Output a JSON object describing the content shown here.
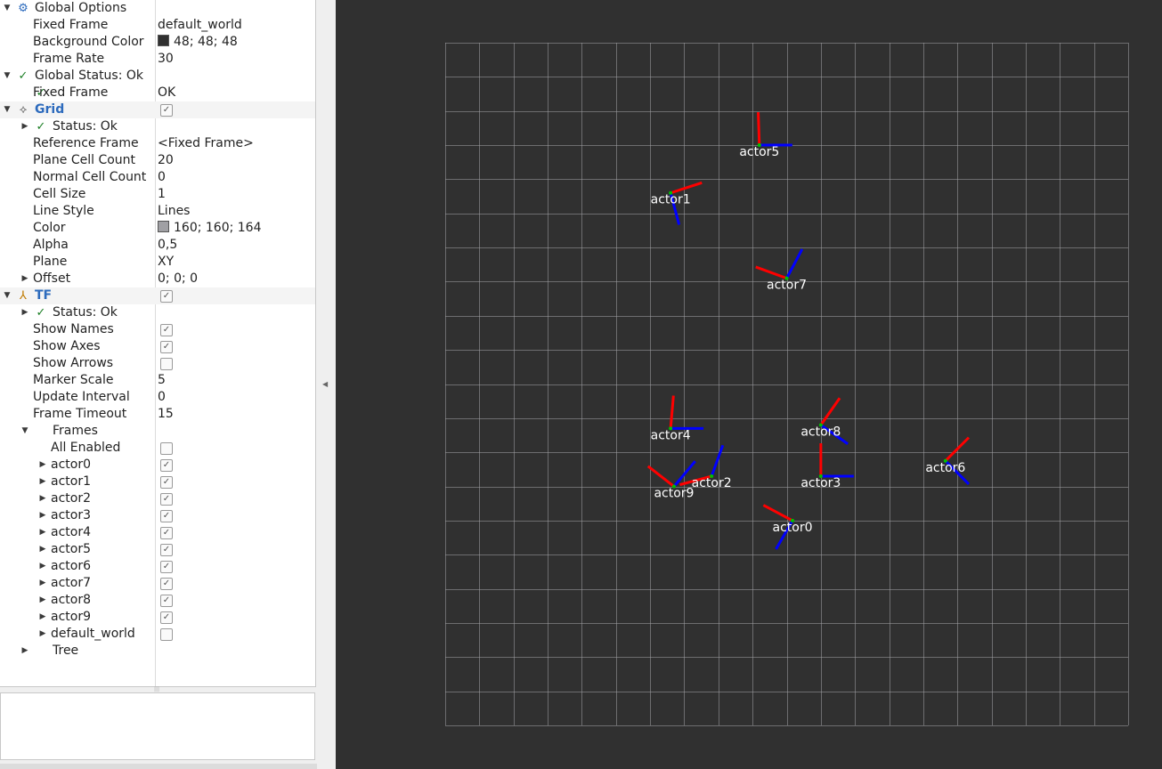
{
  "panel": {
    "rows": [
      {
        "arrow": "▼",
        "icon": "⚙",
        "icon_color": "#2d6bbd",
        "label": "Global Options",
        "value": "",
        "indent": 0,
        "name": "global-options"
      },
      {
        "label": "Fixed Frame",
        "value": "default_world",
        "indent": 2,
        "name": "fixed-frame-row"
      },
      {
        "label": "Background Color",
        "value": "48; 48; 48",
        "swatch": "#303030",
        "indent": 2,
        "name": "background-color-row"
      },
      {
        "label": "Frame Rate",
        "value": "30",
        "indent": 2,
        "name": "frame-rate-row"
      },
      {
        "arrow": "▼",
        "icon": "✓",
        "icon_color": "#1c7f25",
        "label": "Global Status: Ok",
        "value": "",
        "indent": 0,
        "name": "global-status"
      },
      {
        "icon": "✓",
        "icon_color": "#1c7f25",
        "label": "Fixed Frame",
        "value": "OK",
        "indent": 2,
        "name": "fixed-frame-status"
      },
      {
        "arrow": "▼",
        "icon": "⟡",
        "icon_color": "#555555",
        "label": "Grid",
        "value": "",
        "checkbox": true,
        "bold": true,
        "blue": true,
        "selected": true,
        "indent": 0,
        "name": "display-grid"
      },
      {
        "arrow": "▶",
        "icon": "✓",
        "icon_color": "#1c7f25",
        "label": "Status: Ok",
        "value": "",
        "indent": 1,
        "name": "grid-status"
      },
      {
        "label": "Reference Frame",
        "value": "<Fixed Frame>",
        "indent": 2,
        "name": "reference-frame-row"
      },
      {
        "label": "Plane Cell Count",
        "value": "20",
        "indent": 2,
        "name": "plane-cell-count-row"
      },
      {
        "label": "Normal Cell Count",
        "value": "0",
        "indent": 2,
        "name": "normal-cell-count-row"
      },
      {
        "label": "Cell Size",
        "value": "1",
        "indent": 2,
        "name": "cell-size-row"
      },
      {
        "label": "Line Style",
        "value": "Lines",
        "indent": 2,
        "name": "line-style-row"
      },
      {
        "label": "Color",
        "value": "160; 160; 164",
        "swatch": "#a0a0a4",
        "indent": 2,
        "name": "grid-color-row"
      },
      {
        "label": "Alpha",
        "value": "0,5",
        "indent": 2,
        "name": "alpha-row"
      },
      {
        "label": "Plane",
        "value": "XY",
        "indent": 2,
        "name": "plane-row"
      },
      {
        "arrow": "▶",
        "label": "Offset",
        "value": "0; 0; 0",
        "indent": 2,
        "name": "offset-row"
      },
      {
        "arrow": "▼",
        "icon": "⅄",
        "icon_color": "#c07a00",
        "label": "TF",
        "value": "",
        "checkbox": true,
        "bold": true,
        "blue": true,
        "selected": true,
        "indent": 0,
        "name": "display-tf"
      },
      {
        "arrow": "▶",
        "icon": "✓",
        "icon_color": "#1c7f25",
        "label": "Status: Ok",
        "value": "",
        "indent": 1,
        "name": "tf-status"
      },
      {
        "label": "Show Names",
        "value": "",
        "checkbox": true,
        "indent": 2,
        "name": "show-names-row"
      },
      {
        "label": "Show Axes",
        "value": "",
        "checkbox": true,
        "indent": 2,
        "name": "show-axes-row"
      },
      {
        "label": "Show Arrows",
        "value": "",
        "checkbox": false,
        "indent": 2,
        "name": "show-arrows-row"
      },
      {
        "label": "Marker Scale",
        "value": "5",
        "indent": 2,
        "name": "marker-scale-row"
      },
      {
        "label": "Update Interval",
        "value": "0",
        "indent": 2,
        "name": "update-interval-row"
      },
      {
        "label": "Frame Timeout",
        "value": "15",
        "indent": 2,
        "name": "frame-timeout-row"
      },
      {
        "arrow": "▼",
        "label": "Frames",
        "value": "",
        "indent": 1,
        "name": "frames-group"
      },
      {
        "label": "All Enabled",
        "value": "",
        "checkbox": false,
        "indent": 3,
        "name": "all-enabled-row"
      },
      {
        "arrow": "▶",
        "label": "actor0",
        "value": "",
        "checkbox": true,
        "indent": 3,
        "name": "frame-actor0"
      },
      {
        "arrow": "▶",
        "label": "actor1",
        "value": "",
        "checkbox": true,
        "indent": 3,
        "name": "frame-actor1"
      },
      {
        "arrow": "▶",
        "label": "actor2",
        "value": "",
        "checkbox": true,
        "indent": 3,
        "name": "frame-actor2"
      },
      {
        "arrow": "▶",
        "label": "actor3",
        "value": "",
        "checkbox": true,
        "indent": 3,
        "name": "frame-actor3"
      },
      {
        "arrow": "▶",
        "label": "actor4",
        "value": "",
        "checkbox": true,
        "indent": 3,
        "name": "frame-actor4"
      },
      {
        "arrow": "▶",
        "label": "actor5",
        "value": "",
        "checkbox": true,
        "indent": 3,
        "name": "frame-actor5"
      },
      {
        "arrow": "▶",
        "label": "actor6",
        "value": "",
        "checkbox": true,
        "indent": 3,
        "name": "frame-actor6"
      },
      {
        "arrow": "▶",
        "label": "actor7",
        "value": "",
        "checkbox": true,
        "indent": 3,
        "name": "frame-actor7"
      },
      {
        "arrow": "▶",
        "label": "actor8",
        "value": "",
        "checkbox": true,
        "indent": 3,
        "name": "frame-actor8"
      },
      {
        "arrow": "▶",
        "label": "actor9",
        "value": "",
        "checkbox": true,
        "indent": 3,
        "name": "frame-actor9"
      },
      {
        "arrow": "▶",
        "label": "default_world",
        "value": "",
        "checkbox": false,
        "indent": 3,
        "name": "frame-default-world"
      },
      {
        "arrow": "▶",
        "label": "Tree",
        "value": "",
        "indent": 1,
        "name": "tree-group"
      }
    ]
  },
  "viewport": {
    "background": "#303030",
    "grid_color": "#a0a0a4",
    "plane_cell_count": 20,
    "cell_size": 1,
    "axis_colors": {
      "x": "#ff0000",
      "y": "#00c000",
      "z": "#0000ff"
    },
    "frames": [
      {
        "name": "actor0",
        "x": 0.17,
        "y": -4.0,
        "x_axis_angle": -152,
        "z_axis_angle": 120
      },
      {
        "name": "actor1",
        "x": -3.4,
        "y": 5.6,
        "x_axis_angle": -18,
        "z_axis_angle": 75
      },
      {
        "name": "actor2",
        "x": -2.2,
        "y": -2.7,
        "x_axis_angle": 165,
        "z_axis_angle": -70
      },
      {
        "name": "actor3",
        "x": 1.0,
        "y": -2.7,
        "x_axis_angle": -90,
        "z_axis_angle": 0
      },
      {
        "name": "actor4",
        "x": -3.4,
        "y": -1.3,
        "x_axis_angle": -85,
        "z_axis_angle": 0
      },
      {
        "name": "actor5",
        "x": -0.8,
        "y": 7.0,
        "x_axis_angle": -92,
        "z_axis_angle": 0
      },
      {
        "name": "actor6",
        "x": 4.65,
        "y": -2.25,
        "x_axis_angle": -45,
        "z_axis_angle": 45
      },
      {
        "name": "actor7",
        "x": 0.0,
        "y": 3.1,
        "x_axis_angle": -160,
        "z_axis_angle": -62
      },
      {
        "name": "actor8",
        "x": 1.0,
        "y": -1.2,
        "x_axis_angle": -55,
        "z_axis_angle": 35
      },
      {
        "name": "actor9",
        "x": -3.3,
        "y": -3.0,
        "x_axis_angle": -142,
        "z_axis_angle": -50
      }
    ]
  }
}
